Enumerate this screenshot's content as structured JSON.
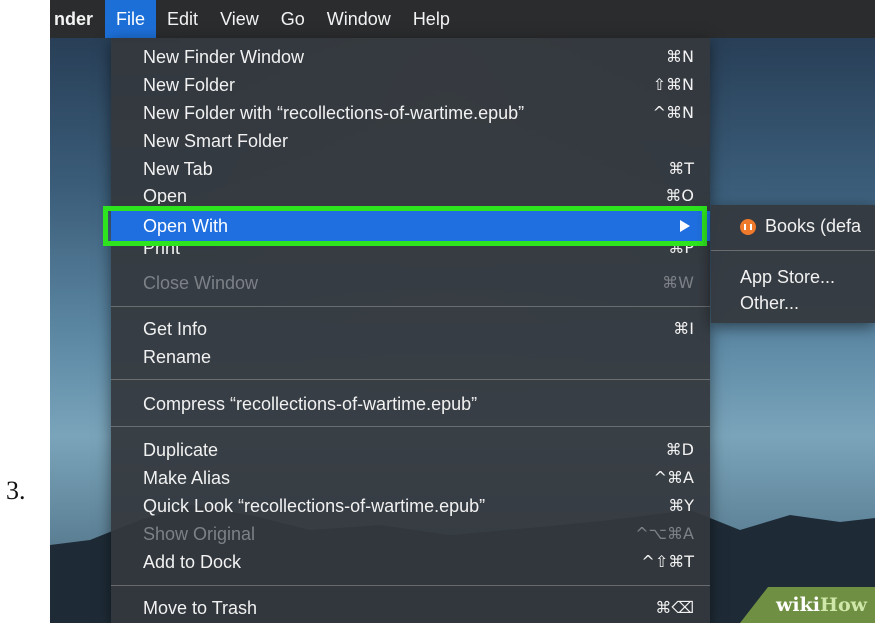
{
  "step_number": "3.",
  "menubar": {
    "app": "nder",
    "items": [
      "File",
      "Edit",
      "View",
      "Go",
      "Window",
      "Help"
    ]
  },
  "file_menu": {
    "items": [
      {
        "label": "New Finder Window",
        "shortcut": "⌘N"
      },
      {
        "label": "New Folder",
        "shortcut": "⇧⌘N"
      },
      {
        "label": "New Folder with “recollections-of-wartime.epub”",
        "shortcut": "^⌘N"
      },
      {
        "label": "New Smart Folder",
        "shortcut": ""
      },
      {
        "label": "New Tab",
        "shortcut": "⌘T"
      },
      {
        "label": "Open",
        "shortcut": "⌘O"
      },
      {
        "label": "Open With",
        "shortcut": ""
      },
      {
        "label": "Print",
        "shortcut": "⌘P"
      },
      {
        "label": "Close Window",
        "shortcut": "⌘W"
      },
      {
        "label": "Get Info",
        "shortcut": "⌘I"
      },
      {
        "label": "Rename",
        "shortcut": ""
      },
      {
        "label": "Compress “recollections-of-wartime.epub”",
        "shortcut": ""
      },
      {
        "label": "Duplicate",
        "shortcut": "⌘D"
      },
      {
        "label": "Make Alias",
        "shortcut": "^⌘A"
      },
      {
        "label": "Quick Look “recollections-of-wartime.epub”",
        "shortcut": "⌘Y"
      },
      {
        "label": "Show Original",
        "shortcut": "^⌥⌘A"
      },
      {
        "label": "Add to Dock",
        "shortcut": "^⇧⌘T"
      },
      {
        "label": "Move to Trash",
        "shortcut": "⌘⌫"
      }
    ]
  },
  "submenu": {
    "default_app": "Books (defa",
    "app_store": "App Store...",
    "other": "Other..."
  },
  "watermark": {
    "wiki": "wiki",
    "how": "How"
  },
  "colors": {
    "highlight_border": "#2ee41f",
    "selection": "#1f6fe0",
    "menubar_active": "#1d6fd8"
  }
}
